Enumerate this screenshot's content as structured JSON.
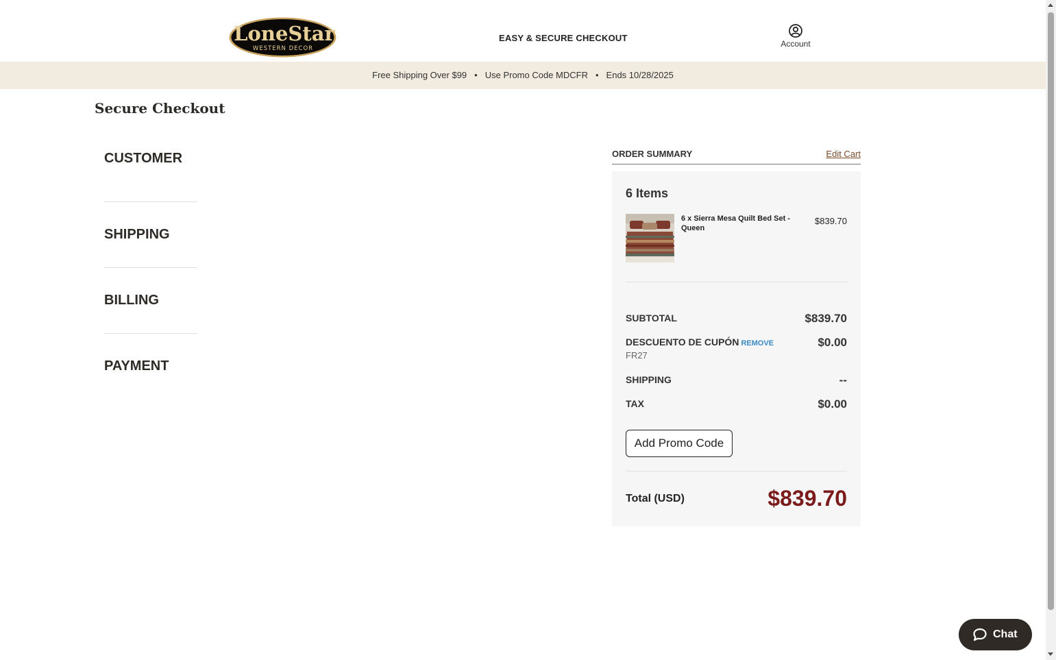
{
  "header": {
    "logo": {
      "main": "LoneStar",
      "sub": "WESTERN DECOR"
    },
    "title": "EASY & SECURE CHECKOUT",
    "account_label": "Account"
  },
  "promo_bar": {
    "items": [
      "Free Shipping Over $99",
      "Use Promo Code MDCFR",
      "Ends 10/28/2025"
    ],
    "separator": "•"
  },
  "page_title": "Secure Checkout",
  "steps": [
    "CUSTOMER",
    "SHIPPING",
    "BILLING",
    "PAYMENT"
  ],
  "order_summary": {
    "title": "ORDER SUMMARY",
    "edit_cart": "Edit Cart",
    "items_count": "6 Items",
    "product": {
      "name": "6 x Sierra Mesa Quilt Bed Set - Queen",
      "price": "$839.70"
    },
    "subtotal": {
      "label": "SUBTOTAL",
      "value": "$839.70"
    },
    "coupon": {
      "label": "DESCUENTO DE CUPÓN",
      "remove": "REMOVE",
      "code": "FR27",
      "value": "$0.00"
    },
    "shipping": {
      "label": "SHIPPING",
      "value": "--"
    },
    "tax": {
      "label": "TAX",
      "value": "$0.00"
    },
    "promo_button": "Add Promo Code",
    "total": {
      "label": "Total (USD)",
      "value": "$839.70"
    }
  },
  "chat": {
    "label": "Chat"
  },
  "colors": {
    "promo_bar_bg": "#f2ebe0",
    "total": "#7a1a1a",
    "remove_link": "#3a8bc4",
    "chat_bg": "#2f2a25"
  }
}
